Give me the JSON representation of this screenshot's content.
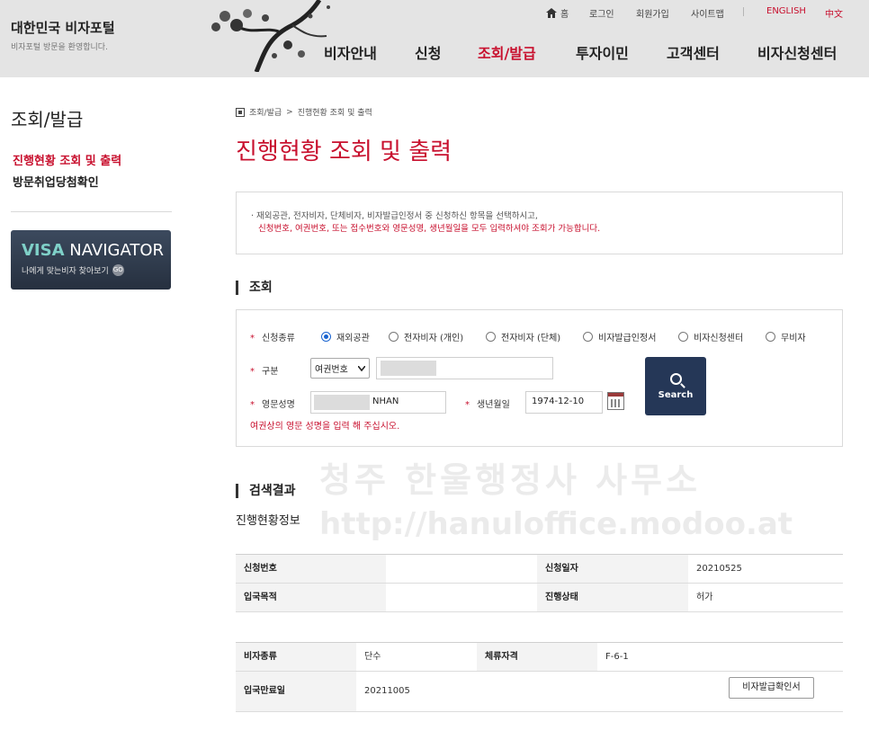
{
  "header": {
    "site_title": "대한민국 비자포털",
    "site_subtitle": "비자포털 방문을 환영합니다.",
    "util": {
      "home": "홈",
      "login": "로그인",
      "signup": "회원가입",
      "sitemap": "사이트맵",
      "english": "ENGLISH",
      "chinese": "中文"
    },
    "gnb": [
      "비자안내",
      "신청",
      "조회/발급",
      "투자이민",
      "고객센터",
      "비자신청센터"
    ]
  },
  "sidebar": {
    "title": "조회/발급",
    "items": [
      "진행현황 조회 및 출력",
      "방문취업당첨확인"
    ],
    "banner": {
      "visa": "VISA",
      "navigator": " NAVIGATOR",
      "sub": "나에게 맞는비자 찾아보기",
      "go": "GO"
    }
  },
  "breadcrumb": {
    "parent": "조회/발급",
    "sep": ">",
    "current": "진행현황 조회 및 출력"
  },
  "page_title": "진행현황 조회 및 출력",
  "notice": {
    "line1": "· 재외공관, 전자비자, 단체비자, 비자발급인정서 중 신청하신 항목을 선택하시고,",
    "line2": "신청번호, 여권번호, 또는 접수번호와 영문성명, 생년월일을 모두 입력하셔야 조회가 가능합니다."
  },
  "search": {
    "section_title": "조회",
    "star": "*",
    "type_label": "신청종류",
    "types": [
      "재외공관",
      "전자비자 (개인)",
      "전자비자 (단체)",
      "비자발급인정서",
      "비자신청센터",
      "무비자"
    ],
    "selected_type": 0,
    "category_label": "구분",
    "category_value": "여권번호",
    "name_label": "영문성명",
    "name_value": "NHAN",
    "birth_label": "생년월일",
    "birth_value": "1974-12-10",
    "hint": "여권상의 영문 성명을 입력 해 주십시오.",
    "button": "Search"
  },
  "watermark": {
    "line1": "청주 한울행정사 사무소",
    "line2": "http://hanuloffice.modoo.at"
  },
  "result": {
    "section_title": "검색결과",
    "subtitle": "진행현황정보",
    "table1": {
      "app_no_label": "신청번호",
      "app_no_value": "",
      "app_date_label": "신청일자",
      "app_date_value": "20210525",
      "purpose_label": "입국목적",
      "purpose_value": "",
      "status_label": "진행상태",
      "status_value": "허가"
    },
    "table2": {
      "visa_type_label": "비자종류",
      "visa_type_value": "단수",
      "status_label": "체류자격",
      "status_value": "F-6-1",
      "expiry_label": "입국만료일",
      "expiry_value": "20211005",
      "confirm_button": "비자발급확인서"
    }
  },
  "colors": {
    "accent": "#c8102e",
    "button": "#253757",
    "header_bg": "#e4e4e4"
  },
  "icons": [
    "home-icon",
    "calendar-icon",
    "search-icon",
    "go-icon",
    "home-box-icon"
  ]
}
